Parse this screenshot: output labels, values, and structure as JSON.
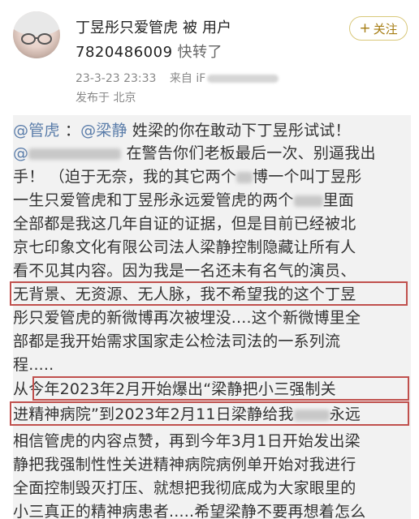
{
  "header": {
    "username": "丁昱彤只爱管虎",
    "by_label": "被",
    "user_label": "用户",
    "user_id": "7820486009",
    "repost_label": "快转了",
    "follow_label": "关注",
    "follow_plus": "+",
    "timestamp": "23-3-23 23:33",
    "source_label": "来自 iF",
    "location": "发布于 北京"
  },
  "post": {
    "lines": [
      {
        "mention1": "@管虎",
        "p1": " ：",
        "mention2": "@梁静",
        "p2": " 姓梁的你在敢动下丁昱彤试试！"
      },
      {
        "mention": "@",
        "text": " 在警告你们老板最后一次、别逼我出"
      },
      {
        "text": "手！ （迫于无奈，我的其它两个",
        "text2": "博一个叫丁昱彤"
      },
      {
        "text": "一生只爱管虎和丁昱彤永远爱管虎的两个",
        "text2": "里面"
      },
      {
        "text": "全部都是我这几年自证的证据，但是目前已经被北"
      },
      {
        "text": "京七印象文化有限公司法人梁静控制隐藏让所有人"
      },
      {
        "text": "看不见其内容。因为我是一名还未有名气的演员、"
      },
      {
        "text": "无背景、无资源、无人脉，我不希望我的这个丁昱"
      },
      {
        "text": "彤只爱管虎的新微博再次被埋没....这个新微博里全"
      },
      {
        "text": "部都是我开始需求国家走公检法司法的一系列流"
      },
      {
        "text": "程....."
      },
      {
        "text": " 从今年2023年2月开始爆出“梁静把小三强制关"
      },
      {
        "text": "进精神病院”到2023年2月11日梁静给我",
        "text2": "永远"
      },
      {
        "text": "相信管虎的内容点赞，再到今年3月1日开始发出梁"
      },
      {
        "text": "静把我强制性性关进精神病院病例单开始对我进行"
      },
      {
        "text": "全面控制毁灭打压、就想把我彻底成为大家眼里的"
      },
      {
        "text": "小三真正的精神病患者.....希望梁静不要再想着怎么"
      }
    ]
  },
  "colors": {
    "mention": "#5b7daa",
    "highlight_box": "#c0504d",
    "follow_border": "#d9c87a",
    "follow_text": "#a67c12",
    "meta_text": "#888888",
    "content_bg": "#f2f2f2"
  },
  "icons": [
    "avatar-image",
    "plus-icon"
  ]
}
